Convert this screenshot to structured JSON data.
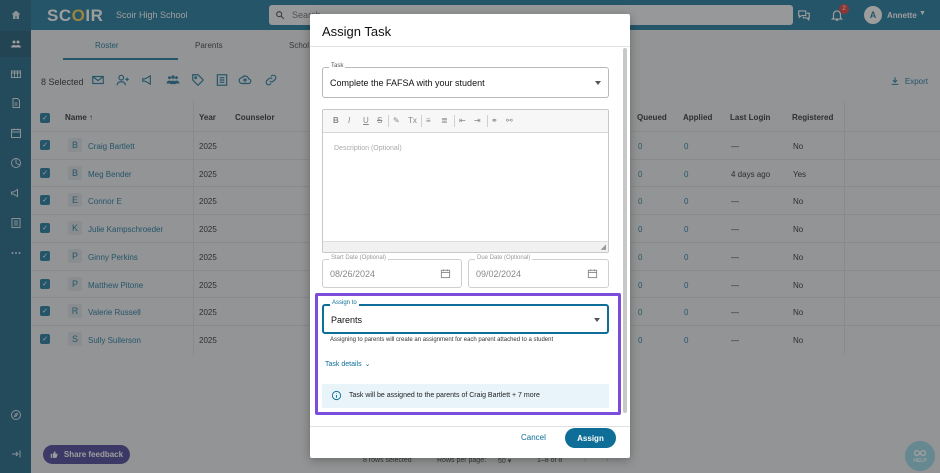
{
  "topbar": {
    "logo_part1": "SC",
    "logo_o": "O",
    "logo_part2": "IR",
    "school_name": "Scoir High School",
    "search_placeholder": "Search",
    "notification_count": "2",
    "user_initial": "A",
    "user_name": "Annette"
  },
  "tabs": [
    {
      "label": "Roster"
    },
    {
      "label": "Parents"
    },
    {
      "label": "Schol"
    }
  ],
  "toolbar": {
    "selected_label": "8 Selected",
    "export_label": "Export",
    "icons": [
      "mail-icon",
      "add-user-icon",
      "megaphone-icon",
      "group-icon",
      "tag-icon",
      "list-icon",
      "cloud-upload-icon",
      "link-icon"
    ]
  },
  "table": {
    "headers": {
      "name": "Name",
      "year": "Year",
      "counselor": "Counselor",
      "queued": "Queued",
      "applied": "Applied",
      "last_login": "Last Login",
      "registered": "Registered"
    },
    "rows": [
      {
        "initial": "B",
        "name": "Craig Bartlett",
        "year": "2025",
        "queued": "0",
        "applied": "0",
        "last_login": "—",
        "registered": "No"
      },
      {
        "initial": "B",
        "name": "Meg Bender",
        "year": "2025",
        "queued": "0",
        "applied": "0",
        "last_login": "4 days ago",
        "registered": "Yes"
      },
      {
        "initial": "E",
        "name": "Connor E",
        "year": "2025",
        "queued": "0",
        "applied": "0",
        "last_login": "—",
        "registered": "No"
      },
      {
        "initial": "K",
        "name": "Julie Kampschroeder",
        "year": "2025",
        "queued": "0",
        "applied": "0",
        "last_login": "—",
        "registered": "No"
      },
      {
        "initial": "P",
        "name": "Ginny Perkins",
        "year": "2025",
        "queued": "0",
        "applied": "0",
        "last_login": "—",
        "registered": "No"
      },
      {
        "initial": "P",
        "name": "Matthew Pitone",
        "year": "2025",
        "queued": "0",
        "applied": "0",
        "last_login": "—",
        "registered": "No"
      },
      {
        "initial": "R",
        "name": "Valerie Russell",
        "year": "2025",
        "queued": "0",
        "applied": "0",
        "last_login": "—",
        "registered": "No"
      },
      {
        "initial": "S",
        "name": "Sully Sullerson",
        "year": "2025",
        "queued": "0",
        "applied": "0",
        "last_login": "—",
        "registered": "No"
      }
    ]
  },
  "footer": {
    "share_feedback": "Share feedback",
    "rows_selected": "8 rows selected",
    "rows_per_page_label": "Rows per page:",
    "rows_per_page_value": "50",
    "range": "1–8 of 8",
    "help_label": "HELP"
  },
  "modal": {
    "title": "Assign Task",
    "task_label": "Task",
    "task_value": "Complete the FAFSA with your student",
    "description_placeholder": "Description (Optional)",
    "start_date_label": "Start Date (Optional)",
    "start_date_value": "08/26/2024",
    "due_date_label": "Due Date (Optional)",
    "due_date_value": "09/02/2024",
    "assign_to_label": "Assign to",
    "assign_to_value": "Parents",
    "helper_text": "Assigning to parents will create an assignment for each parent attached to a student",
    "task_details_label": "Task details",
    "info_text": "Task will be assigned to the parents of Craig Bartlett + 7 more",
    "cancel_label": "Cancel",
    "assign_label": "Assign"
  },
  "rte_tools": [
    "B",
    "I",
    "U",
    "S",
    "✎",
    "Tx",
    "≡",
    "≣",
    "⇤",
    "⇥",
    "⚭",
    "⚯"
  ]
}
